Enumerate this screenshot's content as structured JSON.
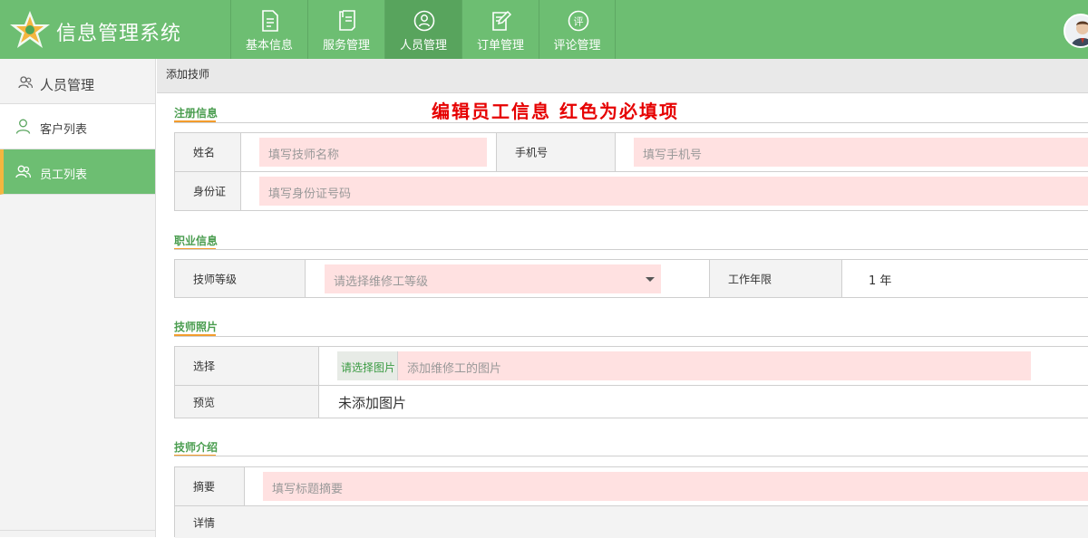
{
  "app": {
    "title": "信息管理系统"
  },
  "nav": {
    "items": [
      {
        "label": "基本信息",
        "icon": "document-icon"
      },
      {
        "label": "服务管理",
        "icon": "receipt-icon"
      },
      {
        "label": "人员管理",
        "icon": "person-circle-icon",
        "active": true
      },
      {
        "label": "订单管理",
        "icon": "edit-form-icon"
      },
      {
        "label": "评论管理",
        "icon": "comment-icon",
        "badge": "评"
      }
    ]
  },
  "sidebar": {
    "header": "人员管理",
    "items": [
      {
        "label": "客户列表",
        "icon": "user-outline-icon"
      },
      {
        "label": "员工列表",
        "icon": "users-icon",
        "active": true
      }
    ]
  },
  "breadcrumb": "添加技师",
  "notice": "编辑员工信息 红色为必填项",
  "sections": {
    "register": {
      "title": "注册信息",
      "name_label": "姓名",
      "name_placeholder": "填写技师名称",
      "phone_label": "手机号",
      "phone_placeholder": "填写手机号",
      "id_label": "身份证",
      "id_placeholder": "填写身份证号码"
    },
    "career": {
      "title": "职业信息",
      "level_label": "技师等级",
      "level_placeholder": "请选择维修工等级",
      "years_label": "工作年限",
      "years_value": "1 年"
    },
    "photo": {
      "title": "技师照片",
      "choose_label": "选择",
      "choose_button": "请选择图片",
      "choose_placeholder": "添加维修工的图片",
      "preview_label": "预览",
      "preview_value": "未添加图片"
    },
    "intro": {
      "title": "技师介绍",
      "summary_label": "摘要",
      "summary_placeholder": "填写标题摘要",
      "detail_label": "详情"
    }
  },
  "colors": {
    "brand_green": "#6dbe72",
    "required_bg": "#ffe1e1",
    "notice_red": "#e60000",
    "accent_orange": "#f39c2c"
  }
}
